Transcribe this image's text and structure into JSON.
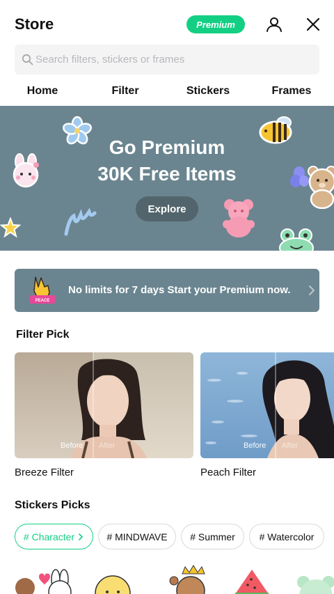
{
  "header": {
    "title": "Store",
    "premium_label": "Premium",
    "user_icon": "user-icon",
    "close_icon": "close-icon",
    "accent_color": "#13cf84"
  },
  "search": {
    "placeholder": "Search filters, stickers or frames",
    "value": "",
    "icon": "search-icon"
  },
  "tabs": [
    {
      "label": "Home"
    },
    {
      "label": "Filter"
    },
    {
      "label": "Stickers"
    },
    {
      "label": "Frames"
    }
  ],
  "banner": {
    "line1": "Go Premium",
    "line2": "30K Free Items",
    "button_label": "Explore",
    "background_color": "#6b8590"
  },
  "promo": {
    "text": "No limits for 7 days Start your Premium now.",
    "icon": "peace-hand-icon",
    "icon_caption": "PEACE",
    "chevron_icon": "chevron-right-icon"
  },
  "filter_pick": {
    "title": "Filter Pick",
    "before_label": "Before",
    "after_label": "After",
    "items": [
      {
        "name": "Breeze Filter"
      },
      {
        "name": "Peach Filter"
      }
    ]
  },
  "stickers_picks": {
    "title": "Stickers Picks",
    "chips": [
      {
        "label": "# Character",
        "active": true
      },
      {
        "label": "# MINDWAVE",
        "active": false
      },
      {
        "label": "# Summer",
        "active": false
      },
      {
        "label": "# Watercolor",
        "active": false
      }
    ]
  }
}
